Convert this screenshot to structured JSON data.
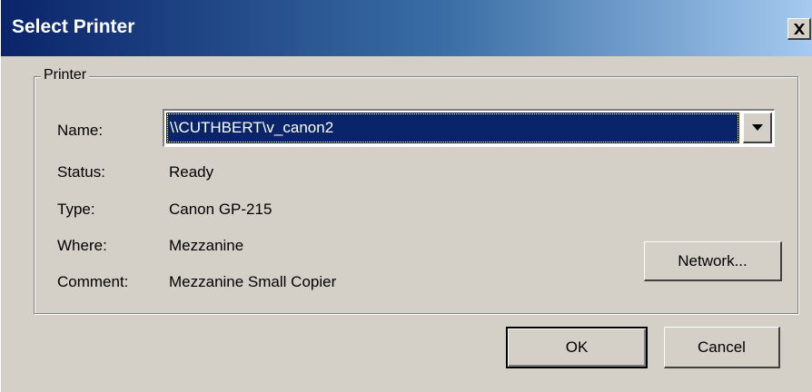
{
  "window": {
    "title": "Select Printer",
    "close_glyph": "✕"
  },
  "printer_group": {
    "legend": "Printer",
    "name_label": "Name:",
    "name_value": "\\\\CUTHBERT\\v_canon2",
    "status_label": "Status:",
    "status_value": "Ready",
    "type_label": "Type:",
    "type_value": "Canon GP-215",
    "where_label": "Where:",
    "where_value": "Mezzanine",
    "comment_label": "Comment:",
    "comment_value": "Mezzanine Small Copier",
    "network_button": "Network..."
  },
  "buttons": {
    "ok": "OK",
    "cancel": "Cancel"
  },
  "icons": {
    "close": "close-icon",
    "dropdown": "chevron-down-icon"
  },
  "colors": {
    "title_start": "#0a246a",
    "title_end": "#a6caf0",
    "face": "#d4d0c8",
    "selection": "#0a246a"
  }
}
